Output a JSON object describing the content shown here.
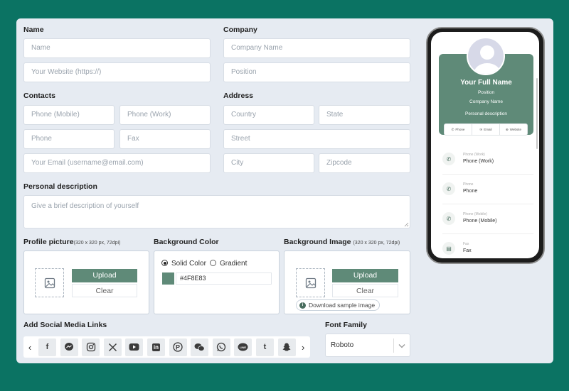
{
  "form": {
    "name_label": "Name",
    "company_label": "Company",
    "name_placeholder": "Name",
    "website_placeholder": "Your Website (https://)",
    "company_name_placeholder": "Company Name",
    "position_placeholder": "Position",
    "contacts_label": "Contacts",
    "address_label": "Address",
    "phone_mobile_placeholder": "Phone (Mobile)",
    "phone_work_placeholder": "Phone (Work)",
    "phone_placeholder": "Phone",
    "fax_placeholder": "Fax",
    "email_placeholder": "Your Email (username@email.com)",
    "country_placeholder": "Country",
    "state_placeholder": "State",
    "street_placeholder": "Street",
    "city_placeholder": "City",
    "zipcode_placeholder": "Zipcode",
    "description_label": "Personal description",
    "description_placeholder": "Give a brief description of yourself",
    "profile_picture_label": "Profile picture",
    "profile_picture_hint": "(320 x 320 px, 72dpi)",
    "bg_color_label": "Background Color",
    "bg_image_label": "Background Image",
    "bg_image_hint": "(320 x 320 px, 72dpi)",
    "upload_label": "Upload",
    "clear_label": "Clear",
    "solid_color_label": "Solid Color",
    "gradient_label": "Gradient",
    "color_value": "#4F8E83",
    "swatch_color": "#5f8a78",
    "download_sample_label": "Download sample image",
    "social_label": "Add Social Media Links",
    "font_family_label": "Font Family",
    "font_family_value": "Roboto"
  },
  "social_icons": [
    "facebook-icon",
    "messenger-icon",
    "instagram-icon",
    "x-icon",
    "youtube-icon",
    "linkedin-icon",
    "pinterest-icon",
    "wechat-icon",
    "whatsapp-icon",
    "line-icon",
    "tumblr-icon",
    "snapchat-icon"
  ],
  "preview": {
    "full_name": "Your Full Name",
    "position": "Position",
    "company_name": "Company Name",
    "description": "Personal description",
    "btn_phone": "Phone",
    "btn_email": "Email",
    "btn_website": "Website",
    "contacts": [
      {
        "label": "Phone (Work)",
        "value": "Phone (Work)"
      },
      {
        "label": "Phone",
        "value": "Phone"
      },
      {
        "label": "Phone (Mobile)",
        "value": "Phone (Mobile)"
      },
      {
        "label": "Fax",
        "value": "Fax"
      }
    ]
  }
}
